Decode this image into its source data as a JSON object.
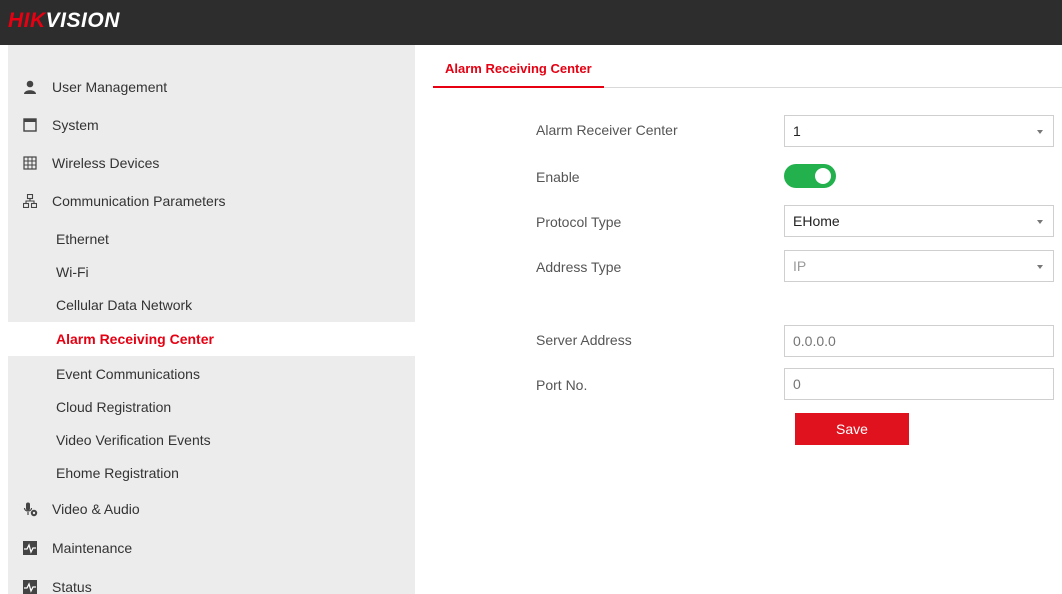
{
  "header": {
    "logo_part1": "HIK",
    "logo_part2": "VISION"
  },
  "sidebar": {
    "items": [
      {
        "label": "User Management",
        "icon": "user-icon"
      },
      {
        "label": "System",
        "icon": "system-icon"
      },
      {
        "label": "Wireless Devices",
        "icon": "wireless-devices-icon"
      },
      {
        "label": "Communication Parameters",
        "icon": "network-icon"
      },
      {
        "label": "Ethernet"
      },
      {
        "label": "Wi-Fi"
      },
      {
        "label": "Cellular Data Network"
      },
      {
        "label": "Alarm Receiving Center",
        "active": true
      },
      {
        "label": "Event Communications"
      },
      {
        "label": "Cloud Registration"
      },
      {
        "label": "Video Verification Events"
      },
      {
        "label": "Ehome Registration"
      },
      {
        "label": "Video & Audio",
        "icon": "microphone-icon"
      },
      {
        "label": "Maintenance",
        "icon": "maintenance-icon"
      },
      {
        "label": "Status",
        "icon": "status-icon"
      }
    ]
  },
  "main": {
    "tab_label": "Alarm Receiving Center",
    "form": {
      "alarm_receiver_center": {
        "label": "Alarm Receiver Center",
        "value": "1"
      },
      "enable": {
        "label": "Enable",
        "value": true
      },
      "protocol_type": {
        "label": "Protocol Type",
        "value": "EHome"
      },
      "address_type": {
        "label": "Address Type",
        "value": "IP"
      },
      "server_address": {
        "label": "Server Address",
        "placeholder": "0.0.0.0"
      },
      "port_no": {
        "label": "Port No.",
        "placeholder": "0"
      }
    },
    "save_label": "Save"
  },
  "colors": {
    "accent": "#e60012",
    "toggle_on": "#22b14c",
    "topbar": "#2d2d2d",
    "sidebar_bg": "#ececec"
  }
}
